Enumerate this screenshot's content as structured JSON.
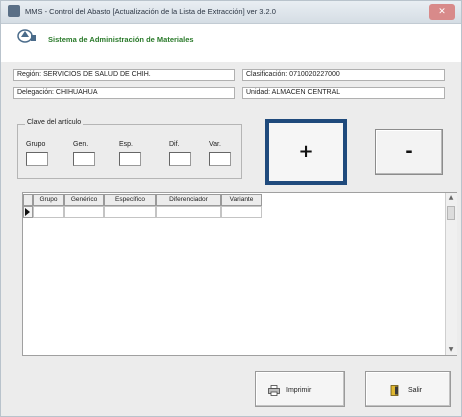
{
  "window": {
    "title": "MMS - Control del Abasto [Actualización de la Lista de Extracción] ver 3.2.0",
    "close_label": "✕"
  },
  "header": {
    "system_title": "Sistema de Administración de Materiales"
  },
  "info": {
    "region": "Región: SERVICIOS DE SALUD DE CHIH.",
    "clasificacion": "Clasificación: 0710020227000",
    "delegacion": "Delegación: CHIHUAHUA",
    "unidad": "Unidad: ALMACEN CENTRAL"
  },
  "article": {
    "legend": "Clave del artículo",
    "fields": [
      {
        "label": "Grupo",
        "value": ""
      },
      {
        "label": "Gen.",
        "value": ""
      },
      {
        "label": "Esp.",
        "value": ""
      },
      {
        "label": "Dif.",
        "value": ""
      },
      {
        "label": "Var.",
        "value": ""
      }
    ]
  },
  "actions": {
    "add_label": "+",
    "remove_label": "-"
  },
  "grid": {
    "columns": [
      "Grupo",
      "Genérico",
      "Específico",
      "Diferenciador",
      "Variante"
    ]
  },
  "footer": {
    "print_label": "Imprimir",
    "exit_label": "Salir"
  },
  "colors": {
    "accent_border": "#1f4a7c",
    "title_green": "#2a7a2a"
  }
}
